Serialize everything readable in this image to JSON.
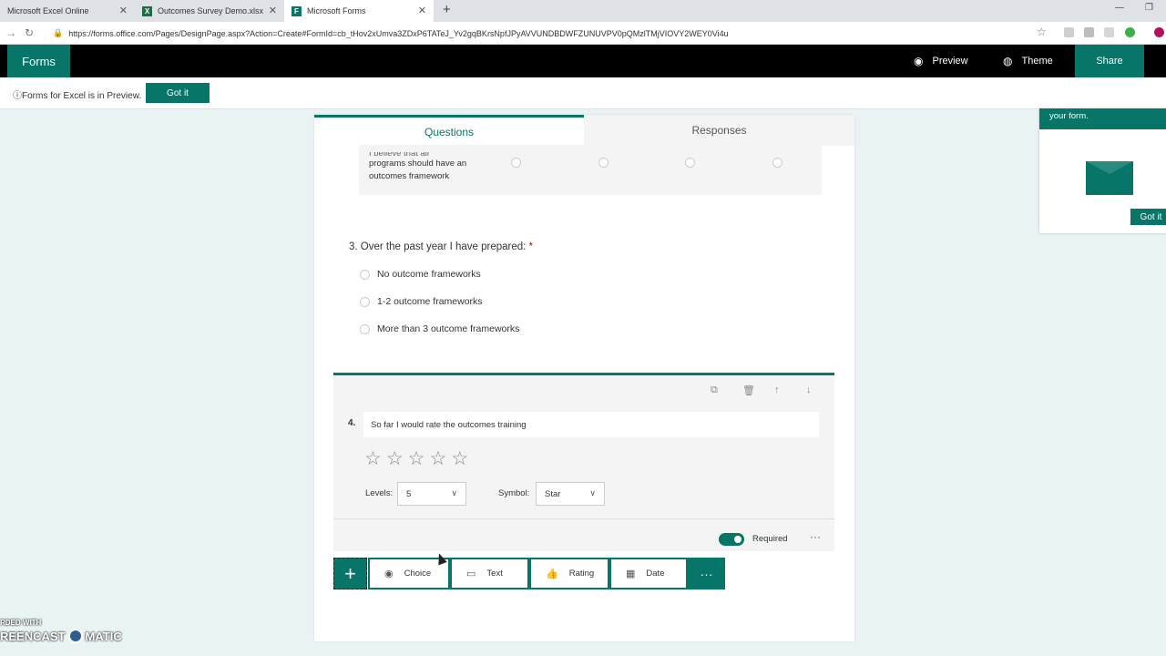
{
  "browser": {
    "tabs": [
      {
        "title": "Microsoft Excel Online"
      },
      {
        "title": "Outcomes Survey Demo.xlsx"
      },
      {
        "title": "Microsoft Forms"
      }
    ],
    "url": "https://forms.office.com/Pages/DesignPage.aspx?Action=Create#FormId=cb_tHov2xUmva3ZDxP6TATeJ_Yv2gqBKrsNpfJPyAVVUNDBDWFZUNUVPV0pQMzlTMjVIOVY2WEY0Vi4u"
  },
  "header": {
    "brand": "Forms",
    "preview_label": "Preview",
    "theme_label": "Theme",
    "share_label": "Share"
  },
  "notice": {
    "text": "Forms for Excel is in Preview.",
    "button_label": "Got it"
  },
  "tabs": {
    "questions": "Questions",
    "responses": "Responses"
  },
  "likert": {
    "statement_cut": "I believe that all",
    "statement": "programs should have an outcomes framework"
  },
  "question3": {
    "number": "3.",
    "title": "Over the past year I have prepared:",
    "required_mark": "*",
    "options": [
      "No outcome frameworks",
      "1-2 outcome frameworks",
      "More than 3 outcome frameworks"
    ]
  },
  "question4": {
    "number": "4.",
    "title": "So far I would rate the outcomes training",
    "star_glyph": "☆",
    "levels_label": "Levels:",
    "levels_value": "5",
    "symbol_label": "Symbol:",
    "symbol_value": "Star",
    "required_label": "Required",
    "required_on": true
  },
  "add_bar": {
    "choice": "Choice",
    "text": "Text",
    "rating": "Rating",
    "date": "Date"
  },
  "coach": {
    "text": "your form.",
    "button_label": "Got it"
  },
  "watermark": {
    "line1": "RDED WITH",
    "line2a": "REENCAST",
    "line2b": "MATIC"
  },
  "colors": {
    "accent": "#077568",
    "required": "#cc0000"
  }
}
